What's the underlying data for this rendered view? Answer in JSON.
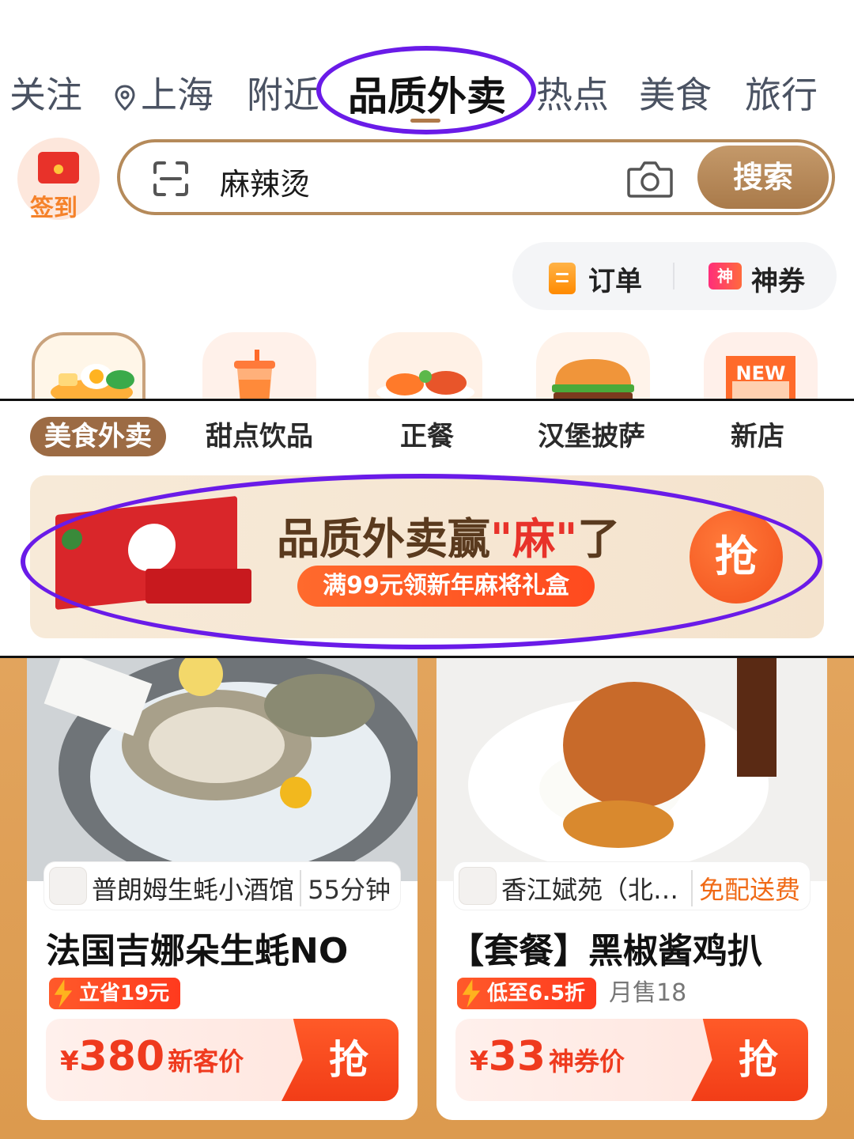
{
  "nav": {
    "items": [
      "关注",
      "上海",
      "附近",
      "品质外卖",
      "热点",
      "美食",
      "旅行"
    ],
    "active": "品质外卖"
  },
  "signin": {
    "label": "签到"
  },
  "search": {
    "query": "麻辣烫",
    "button_label": "搜索"
  },
  "quick_links": {
    "orders_label": "订单",
    "coupons_label": "神券",
    "coupon_badge": "神"
  },
  "category_icons": {
    "new_badge": "NEW"
  },
  "category_tabs": [
    "美食外卖",
    "甜点饮品",
    "正餐",
    "汉堡披萨",
    "新店"
  ],
  "banner": {
    "title_prefix": "品质外卖赢",
    "title_highlight": "\"麻\"",
    "title_suffix": "了",
    "subtitle": "满99元领新年麻将礼盒",
    "button_label": "抢"
  },
  "products": [
    {
      "shop_name": "普朗姆生蚝小酒馆",
      "shop_meta": "55分钟",
      "dish_name": "法国吉娜朵生蚝NO",
      "tag": "立省19元",
      "sales": "",
      "currency": "¥",
      "price": "380",
      "price_label": "新客价",
      "button_label": "抢"
    },
    {
      "shop_name": "香江娬苑（北…",
      "shop_meta": "免配送费",
      "dish_name": "【套餐】黑椒酱鸡扒",
      "tag": "低至6.5折",
      "sales": "月售18",
      "currency": "¥",
      "price": "33",
      "price_label": "神券价",
      "button_label": "抢"
    }
  ],
  "colors": {
    "accent_brown": "#9c6b44",
    "search_border": "#b58a5a",
    "promo_red": "#ef3a1e",
    "annotation_purple": "#6a1be8",
    "feed_background": "#e2a45d"
  }
}
